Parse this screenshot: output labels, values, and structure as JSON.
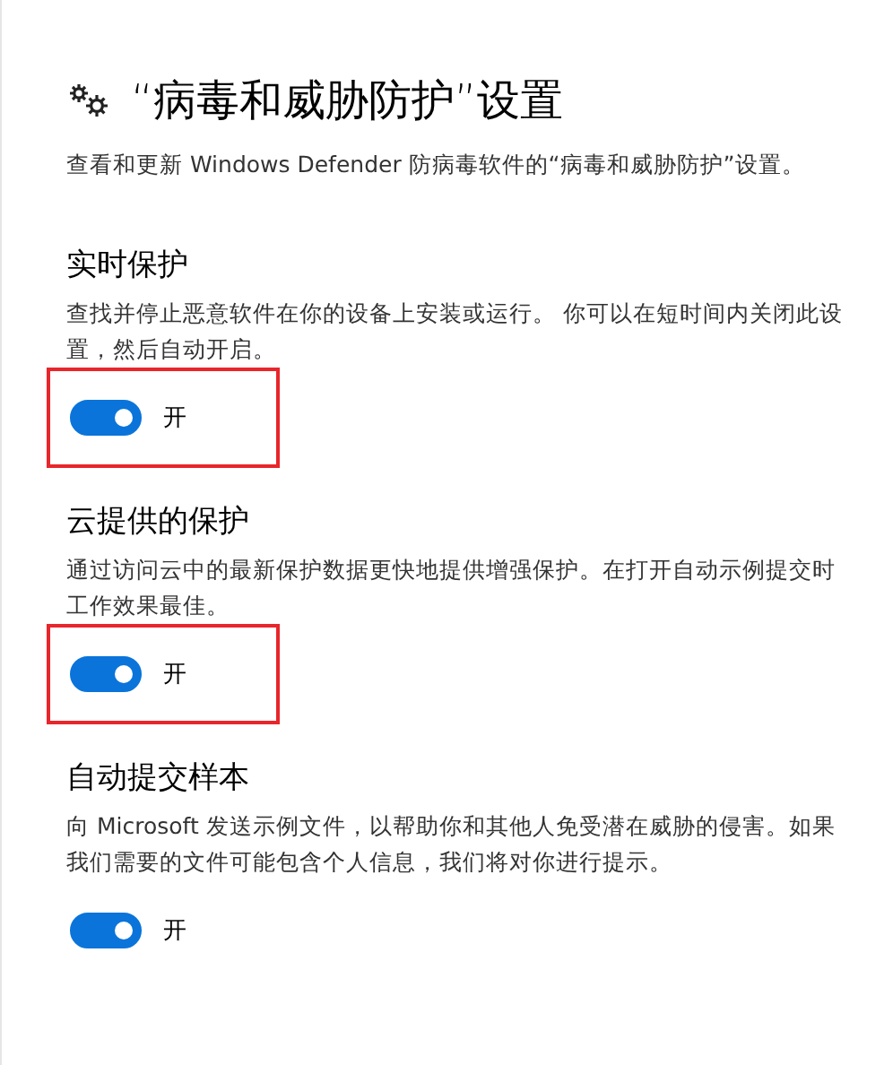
{
  "header": {
    "title": "“病毒和威胁防护”设置",
    "description": "查看和更新 Windows Defender 防病毒软件的“病毒和威胁防护”设置。"
  },
  "settings": [
    {
      "title": "实时保护",
      "description": "查找并停止恶意软件在你的设备上安装或运行。 你可以在短时间内关闭此设置，然后自动开启。",
      "on": true,
      "state_label": "开",
      "highlighted": true
    },
    {
      "title": "云提供的保护",
      "description": "通过访问云中的最新保护数据更快地提供增强保护。在打开自动示例提交时工作效果最佳。",
      "on": true,
      "state_label": "开",
      "highlighted": true
    },
    {
      "title": "自动提交样本",
      "description": "向 Microsoft 发送示例文件，以帮助你和其他人免受潜在威胁的侵害。如果我们需要的文件可能包含个人信息，我们将对你进行提示。",
      "on": true,
      "state_label": "开",
      "highlighted": false
    }
  ]
}
